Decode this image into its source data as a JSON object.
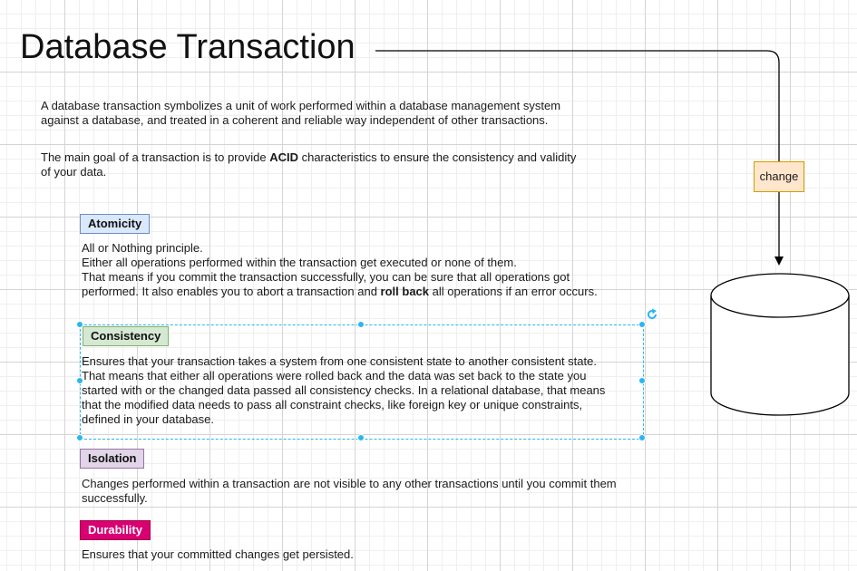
{
  "title": "Database Transaction",
  "intro": {
    "line1a": "A database transaction symbolizes a unit of work performed within a database management system",
    "line1b": "against a database, and treated in a coherent and reliable way independent of other transactions.",
    "line2a_pre": "The main goal of a transaction is to provide ",
    "line2a_bold": "ACID",
    "line2a_post": " characteristics to ensure the consistency and validity",
    "line2b": "of your data."
  },
  "atomicity": {
    "label": "Atomicity",
    "l1": "All or Nothing principle.",
    "l2": "Either all operations performed within the transaction get executed or none of them.",
    "l3": "That means if you commit the transaction successfully, you can be sure that all operations got",
    "l4_pre": "performed. It also enables you to abort a transaction and ",
    "l4_bold": "roll back",
    "l4_post": " all operations if an error occurs."
  },
  "consistency": {
    "label": "Consistency",
    "l1": "Ensures that your transaction takes a system from one consistent state to another consistent state.",
    "l2": "That means that either all operations were rolled back and the data was set back to the state you",
    "l3": "started with or the changed data passed all consistency checks. In a relational database, that means",
    "l4": "that the modified data needs to pass all constraint checks, like foreign key or unique constraints,",
    "l5": "defined in your database."
  },
  "isolation": {
    "label": "Isolation",
    "l1": "Changes performed within a transaction are not visible to any other transactions until you commit them",
    "l2": "successfully."
  },
  "durability": {
    "label": "Durability",
    "l1": "Ensures that your committed changes get persisted."
  },
  "connector": {
    "label": "change"
  },
  "colors": {
    "atomicity_fill": "#dae8fc",
    "consistency_fill": "#d5e8d4",
    "isolation_fill": "#e1d5e7",
    "durability_fill": "#d80073",
    "change_fill": "#ffe6cc",
    "selection": "#29b6f2"
  },
  "icons": {
    "database": "database-cylinder-icon",
    "rotate": "rotate-handle-icon"
  }
}
